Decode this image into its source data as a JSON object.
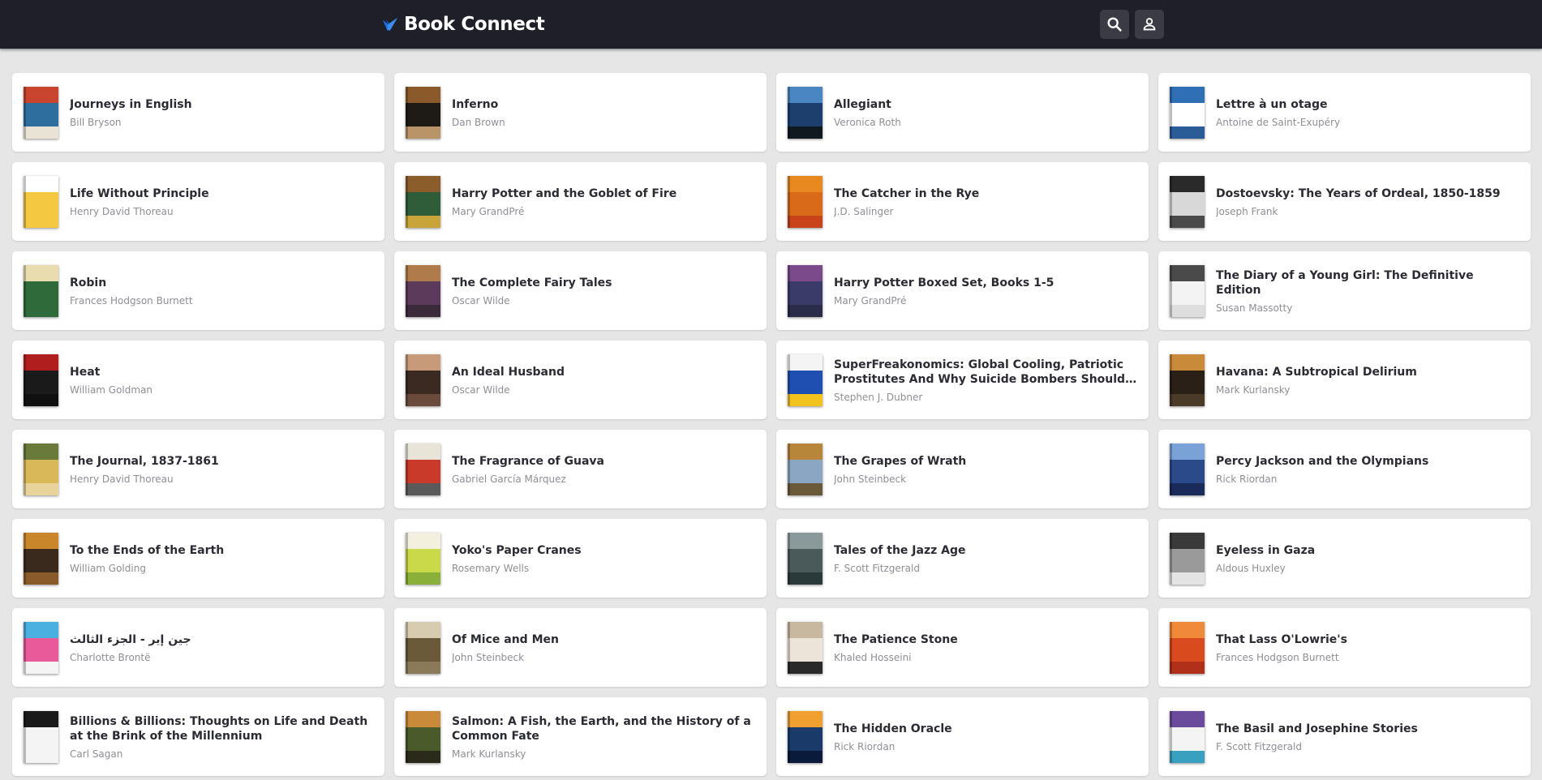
{
  "app": {
    "title": "Book Connect",
    "accent": "#1a73e8",
    "header_bg": "#1f1f2a"
  },
  "header": {
    "search_icon": "search-icon",
    "profile_icon": "person-icon"
  },
  "books": [
    {
      "title": "Journeys in English",
      "author": "Bill Bryson",
      "cover": [
        "#2e6e9e",
        "#c9452f",
        "#e8e3d4"
      ]
    },
    {
      "title": "Inferno",
      "author": "Dan Brown",
      "cover": [
        "#1e1a16",
        "#8a5a2b",
        "#b89468"
      ]
    },
    {
      "title": "Allegiant",
      "author": "Veronica Roth",
      "cover": [
        "#1d3f6e",
        "#4a86c2",
        "#101820"
      ]
    },
    {
      "title": "Lettre à un otage",
      "author": "Antoine de Saint-Exupéry",
      "cover": [
        "#ffffff",
        "#2f6fb6",
        "#2a5d98"
      ]
    },
    {
      "title": "Life Without Principle",
      "author": "Henry David Thoreau",
      "cover": [
        "#f5c842",
        "#ffffff",
        "#f5c842"
      ]
    },
    {
      "title": "Harry Potter and the Goblet of Fire",
      "author": "Mary GrandPré",
      "cover": [
        "#2f5d3a",
        "#8b5d2b",
        "#c9a43a"
      ]
    },
    {
      "title": "The Catcher in the Rye",
      "author": "J.D. Salinger",
      "cover": [
        "#d96a1a",
        "#e8891f",
        "#c9431a"
      ]
    },
    {
      "title": "Dostoevsky: The Years of Ordeal, 1850-1859",
      "author": "Joseph Frank",
      "cover": [
        "#d8d8d8",
        "#2a2a2a",
        "#4a4a4a"
      ]
    },
    {
      "title": "Robin",
      "author": "Frances Hodgson Burnett",
      "cover": [
        "#2f6b3a",
        "#e9dcae",
        "#2f6b3a"
      ]
    },
    {
      "title": "The Complete Fairy Tales",
      "author": "Oscar Wilde",
      "cover": [
        "#5b3a5c",
        "#b07b4a",
        "#3b2a3a"
      ]
    },
    {
      "title": "Harry Potter Boxed Set, Books 1-5",
      "author": "Mary GrandPré",
      "cover": [
        "#3b3b6a",
        "#7a4a8a",
        "#2b2b4a"
      ]
    },
    {
      "title": "The Diary of a Young Girl: The Definitive Edition",
      "author": "Susan Massotty",
      "cover": [
        "#f3f3f3",
        "#4a4a4a",
        "#dedede"
      ]
    },
    {
      "title": "Heat",
      "author": "William Goldman",
      "cover": [
        "#1a1a1a",
        "#b01e1e",
        "#101010"
      ]
    },
    {
      "title": "An Ideal Husband",
      "author": "Oscar Wilde",
      "cover": [
        "#3a2a22",
        "#c79a7a",
        "#6a4a3a"
      ]
    },
    {
      "title": "SuperFreakonomics: Global Cooling, Patriotic Prostitutes And Why Suicide Bombers Should Buy Life Insurance",
      "author": "Stephen J. Dubner",
      "cover": [
        "#1f4fb0",
        "#f4f4f4",
        "#f2c21e"
      ]
    },
    {
      "title": "Havana: A Subtropical Delirium",
      "author": "Mark Kurlansky",
      "cover": [
        "#2a2018",
        "#c98a3a",
        "#4a3a28"
      ]
    },
    {
      "title": "The Journal, 1837-1861",
      "author": "Henry David Thoreau",
      "cover": [
        "#d9b85a",
        "#6a7a3a",
        "#e8d49a"
      ]
    },
    {
      "title": "The Fragrance of Guava",
      "author": "Gabriel García Márquez",
      "cover": [
        "#c93a2a",
        "#e9e4d8",
        "#5a5a5a"
      ]
    },
    {
      "title": "The Grapes of Wrath",
      "author": "John Steinbeck",
      "cover": [
        "#8aa6c2",
        "#b8863a",
        "#6a5a3a"
      ]
    },
    {
      "title": "Percy Jackson and the Olympians",
      "author": "Rick Riordan",
      "cover": [
        "#2a4a8a",
        "#7aa2d6",
        "#1a2a5a"
      ]
    },
    {
      "title": "To the Ends of the Earth",
      "author": "William Golding",
      "cover": [
        "#3a2a1e",
        "#c9862a",
        "#8a5a2a"
      ]
    },
    {
      "title": "Yoko's Paper Cranes",
      "author": "Rosemary Wells",
      "cover": [
        "#c9d94a",
        "#f4f0e0",
        "#8ab03a"
      ]
    },
    {
      "title": "Tales of the Jazz Age",
      "author": "F. Scott Fitzgerald",
      "cover": [
        "#4a5a5a",
        "#8a9a9a",
        "#2a3a3a"
      ]
    },
    {
      "title": "Eyeless in Gaza",
      "author": "Aldous Huxley",
      "cover": [
        "#9a9a9a",
        "#3a3a3a",
        "#e4e4e4"
      ]
    },
    {
      "title": "جين إير - الجزء الثالث",
      "author": "Charlotte Brontë",
      "cover": [
        "#e85a9a",
        "#4ab0e0",
        "#f4f4f4"
      ]
    },
    {
      "title": "Of Mice and Men",
      "author": "John Steinbeck",
      "cover": [
        "#6a5a3a",
        "#d8ccb0",
        "#8a7a5a"
      ]
    },
    {
      "title": "The Patience Stone",
      "author": "Khaled Hosseini",
      "cover": [
        "#ece4d8",
        "#c9b8a0",
        "#2a2a2a"
      ]
    },
    {
      "title": "That Lass O'Lowrie's",
      "author": "Frances Hodgson Burnett",
      "cover": [
        "#d94a1e",
        "#f08a3a",
        "#b0301a"
      ]
    },
    {
      "title": "Billions & Billions: Thoughts on Life and Death at the Brink of the Millennium",
      "author": "Carl Sagan",
      "cover": [
        "#f4f4f4",
        "#1a1a1a",
        "#f4f4f4"
      ]
    },
    {
      "title": "Salmon: A Fish, the Earth, and the History of a Common Fate",
      "author": "Mark Kurlansky",
      "cover": [
        "#4a5a2a",
        "#c98a3a",
        "#2a2a1a"
      ]
    },
    {
      "title": "The Hidden Oracle",
      "author": "Rick Riordan",
      "cover": [
        "#1a3a6a",
        "#f0a030",
        "#0a1a3a"
      ]
    },
    {
      "title": "The Basil and Josephine Stories",
      "author": "F. Scott Fitzgerald",
      "cover": [
        "#f4f4f4",
        "#6a4a9a",
        "#3aa0c0"
      ]
    }
  ]
}
